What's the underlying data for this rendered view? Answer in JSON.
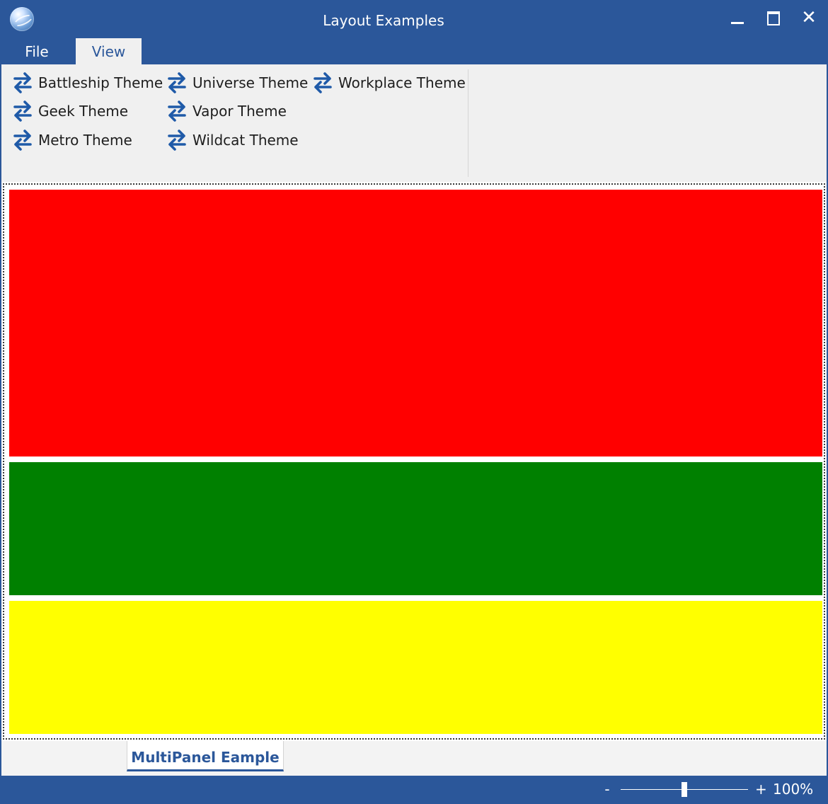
{
  "window": {
    "title": "Layout Examples"
  },
  "menu_tabs": {
    "file": "File",
    "view": "View"
  },
  "ribbon": {
    "themes": [
      {
        "label": "Battleship Theme",
        "icon": "swap-arrows-icon"
      },
      {
        "label": "Geek Theme",
        "icon": "swap-arrows-icon"
      },
      {
        "label": "Metro Theme",
        "icon": "swap-arrows-icon"
      },
      {
        "label": "Universe Theme",
        "icon": "swap-arrows-icon"
      },
      {
        "label": "Vapor Theme",
        "icon": "swap-arrows-icon"
      },
      {
        "label": "Wildcat Theme",
        "icon": "swap-arrows-icon"
      },
      {
        "label": "Workplace Theme",
        "icon": "swap-arrows-icon"
      }
    ]
  },
  "panels": [
    {
      "name": "red",
      "color": "#ff0000"
    },
    {
      "name": "green",
      "color": "#008000"
    },
    {
      "name": "yellow",
      "color": "#ffff00"
    }
  ],
  "bottom_tabs": {
    "active": "MultiPanel Eample"
  },
  "statusbar": {
    "zoom_minus": "-",
    "zoom_plus": "+",
    "zoom_level": "100%",
    "zoom_slider_fraction": 0.5
  },
  "colors": {
    "accent": "#2b579a",
    "ribbon_bg": "#f0f0f0",
    "icon_blue": "#1f5aa8"
  }
}
